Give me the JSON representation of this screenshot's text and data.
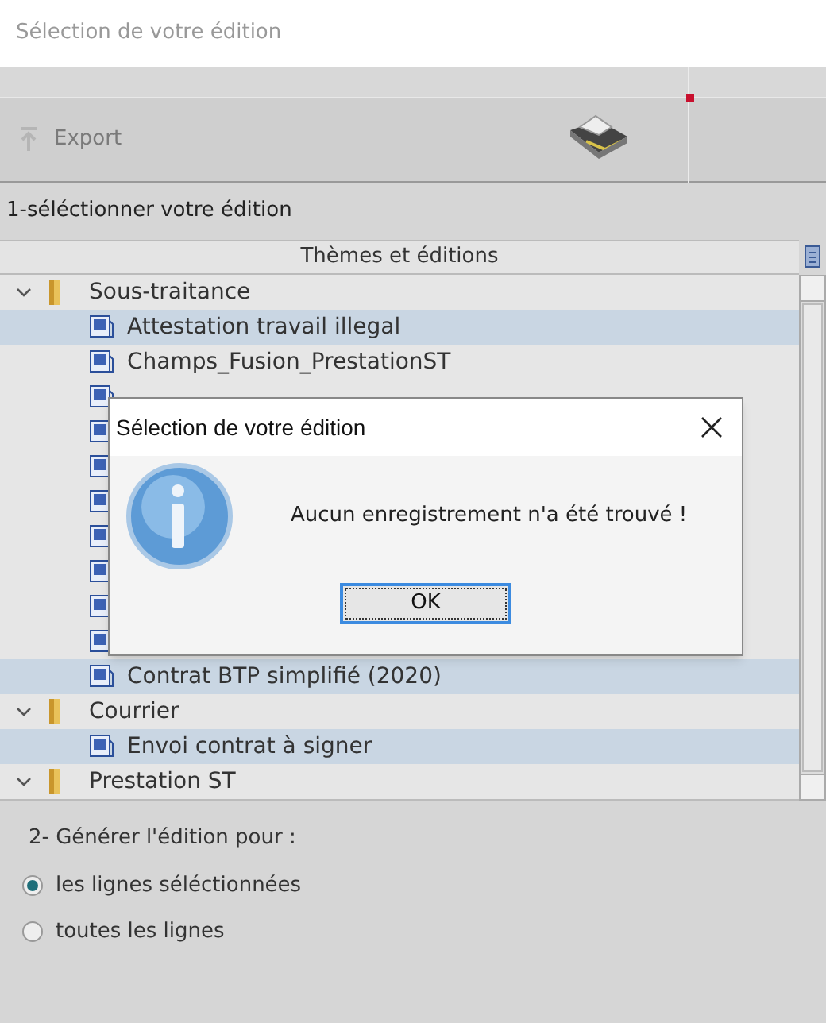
{
  "window": {
    "title": "Sélection de votre édition"
  },
  "toolbar": {
    "export_button": {
      "label": "Export",
      "disabled": true
    }
  },
  "section_1": {
    "label": "1-séléctionner votre édition"
  },
  "tree": {
    "column": "Thèmes et éditions",
    "items": [
      {
        "kind": "folder",
        "label": "Sous-traitance",
        "expanded": true,
        "children": [
          {
            "kind": "document",
            "label": "Attestation travail illegal",
            "selected": true
          },
          {
            "kind": "document",
            "label": "Champs_Fusion_PrestationST",
            "selected": false
          },
          {
            "kind": "document",
            "selected": false
          },
          {
            "kind": "document",
            "selected": false
          },
          {
            "kind": "document",
            "selected": false
          },
          {
            "kind": "document",
            "selected": false
          },
          {
            "kind": "document",
            "selected": false
          },
          {
            "kind": "document",
            "selected": false
          },
          {
            "kind": "document",
            "selected": false
          },
          {
            "kind": "document",
            "selected": false
          },
          {
            "kind": "document",
            "label": "Contrat BTP simplifié (2020)",
            "selected": true
          }
        ]
      },
      {
        "kind": "folder",
        "label": "Courrier",
        "expanded": true,
        "children": [
          {
            "kind": "document",
            "label": "Envoi contrat à signer",
            "selected": true
          }
        ]
      },
      {
        "kind": "folder",
        "label": "Prestation ST",
        "expanded": true
      }
    ]
  },
  "section_2": {
    "label": "2- Générer l'édition pour :",
    "options": [
      {
        "label": "les lignes séléctionnées",
        "selected": true
      },
      {
        "label": "toutes les lignes",
        "selected": false
      }
    ]
  },
  "dialog": {
    "title": "Sélection de votre édition",
    "message": "Aucun enregistrement n'a été trouvé !",
    "button": "OK"
  }
}
